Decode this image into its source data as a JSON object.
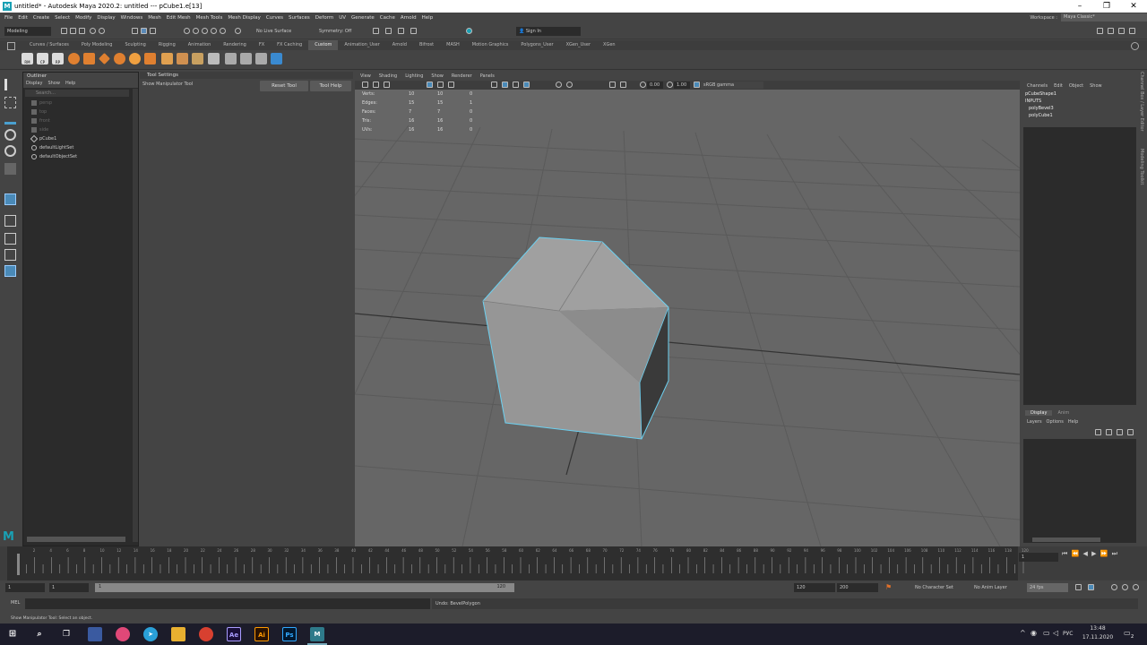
{
  "window": {
    "title": "untitled* - Autodesk Maya 2020.2: untitled   ---   pCube1.e[13]",
    "logo": "M",
    "controls": [
      "minimize-icon",
      "maximize-icon",
      "close-icon"
    ]
  },
  "menubar": [
    "File",
    "Edit",
    "Create",
    "Select",
    "Modify",
    "Display",
    "Windows",
    "Mesh",
    "Edit Mesh",
    "Mesh Tools",
    "Mesh Display",
    "Curves",
    "Surfaces",
    "Deform",
    "UV",
    "Generate",
    "Cache",
    "Arnold",
    "Help"
  ],
  "workspace": {
    "label": "Workspace :",
    "value": "Maya Classic*"
  },
  "statusline": {
    "mode": "Modeling",
    "live_surface": "No Live Surface",
    "symmetry": "Symmetry: Off",
    "sign_in": "Sign In"
  },
  "shelf_tabs": [
    "Curves / Surfaces",
    "Poly Modeling",
    "Sculpting",
    "Rigging",
    "Animation",
    "Rendering",
    "FX",
    "FX Caching",
    "Custom",
    "Animation_User",
    "Arnold",
    "Bifrost",
    "MASH",
    "Motion Graphics",
    "Polygons_User",
    "XGen_User",
    "XGen"
  ],
  "shelf_active": "Custom",
  "shelf_labels": [
    "RM",
    "CP",
    "RP"
  ],
  "outliner": {
    "title": "Outliner",
    "menu": [
      "Display",
      "Show",
      "Help"
    ],
    "search_placeholder": "Search...",
    "items": [
      {
        "label": "persp",
        "dim": true
      },
      {
        "label": "top",
        "dim": true
      },
      {
        "label": "front",
        "dim": true
      },
      {
        "label": "side",
        "dim": true
      },
      {
        "label": "pCube1",
        "dim": false
      },
      {
        "label": "defaultLightSet",
        "dim": false
      },
      {
        "label": "defaultObjectSet",
        "dim": false
      }
    ]
  },
  "tool_settings": {
    "title": "Tool Settings",
    "tool_name": "Show Manipulator Tool",
    "reset_label": "Reset Tool",
    "help_label": "Tool Help"
  },
  "viewport": {
    "menu": [
      "View",
      "Shading",
      "Lighting",
      "Show",
      "Renderer",
      "Panels"
    ],
    "exposure": "0.00",
    "gamma": "1.00",
    "color_space": "sRGB gamma",
    "hud": [
      {
        "label": "Verts:",
        "a": "10",
        "b": "10",
        "c": "0"
      },
      {
        "label": "Edges:",
        "a": "15",
        "b": "15",
        "c": "1"
      },
      {
        "label": "Faces:",
        "a": "7",
        "b": "7",
        "c": "0"
      },
      {
        "label": "Tris:",
        "a": "16",
        "b": "16",
        "c": "0"
      },
      {
        "label": "UVs:",
        "a": "16",
        "b": "16",
        "c": "0"
      }
    ]
  },
  "channel_box": {
    "menu": [
      "Channels",
      "Edit",
      "Object",
      "Show"
    ],
    "shape": "pCubeShape1",
    "inputs_label": "INPUTS",
    "inputs": [
      "polyBevel3",
      "polyCube1"
    ],
    "side_tabs": [
      "Channel Box / Layer Editor",
      "Modeling Toolkit"
    ]
  },
  "layer_editor": {
    "tabs": [
      "Display",
      "Anim"
    ],
    "menu": [
      "Layers",
      "Options",
      "Help"
    ]
  },
  "timeline": {
    "ticks": [
      "2",
      "4",
      "6",
      "8",
      "10",
      "12",
      "14",
      "16",
      "18",
      "20",
      "22",
      "24",
      "26",
      "28",
      "30",
      "32",
      "34",
      "36",
      "38",
      "40",
      "42",
      "44",
      "46",
      "48",
      "50",
      "52",
      "54",
      "56",
      "58",
      "60",
      "62",
      "64",
      "66",
      "68",
      "70",
      "72",
      "74",
      "76",
      "78",
      "80",
      "82",
      "84",
      "86",
      "88",
      "90",
      "92",
      "94",
      "96",
      "98",
      "100",
      "102",
      "104",
      "106",
      "108",
      "110",
      "112",
      "114",
      "116",
      "118",
      "120"
    ],
    "current_frame": "1"
  },
  "range": {
    "start": "1",
    "inner_start": "1",
    "slider_start": "1",
    "slider_end": "120",
    "end": "120",
    "outer_end": "200",
    "character_set": "No Character Set",
    "anim_layer": "No Anim Layer",
    "fps": "24 fps"
  },
  "command_line": {
    "label": "MEL",
    "result": "Undo: BevelPolygon"
  },
  "help_line": "Show Manipulator Tool: Select an object.",
  "taskbar": {
    "apps": [
      {
        "name": "start",
        "label": ""
      },
      {
        "name": "search",
        "label": ""
      },
      {
        "name": "task-view",
        "label": ""
      },
      {
        "name": "app1",
        "label": ""
      },
      {
        "name": "itunes",
        "label": ""
      },
      {
        "name": "telegram",
        "label": ""
      },
      {
        "name": "explorer",
        "label": ""
      },
      {
        "name": "chrome",
        "label": ""
      },
      {
        "name": "after-effects",
        "label": "Ae"
      },
      {
        "name": "illustrator",
        "label": "Ai"
      },
      {
        "name": "photoshop",
        "label": "Ps"
      },
      {
        "name": "maya",
        "label": "M"
      }
    ],
    "lang": "РУС",
    "time": "13:48",
    "date": "17.11.2020",
    "notifications": "2"
  }
}
